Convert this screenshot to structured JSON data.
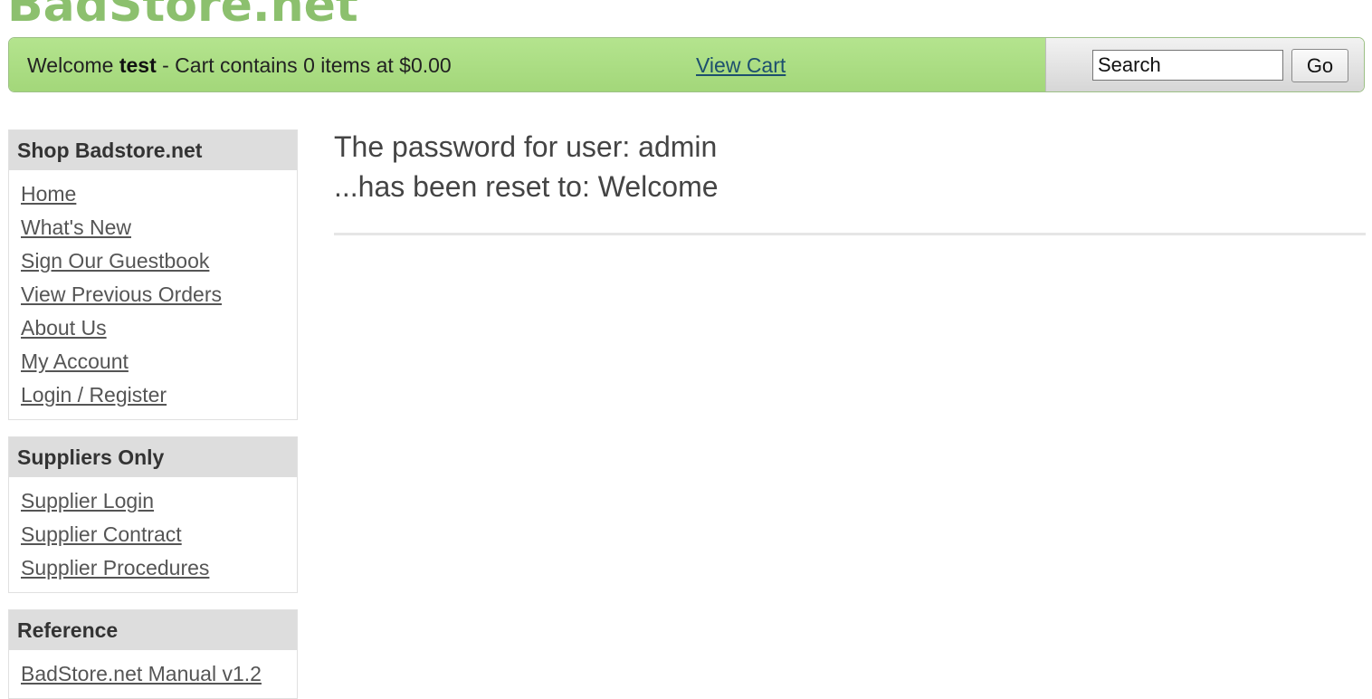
{
  "logo": {
    "text": "BadStore.net"
  },
  "topbar": {
    "welcome_prefix": "Welcome ",
    "username": "test",
    "cart_summary": " - Cart contains 0 items at $0.00",
    "view_cart_label": "View Cart",
    "search_value": "Search",
    "go_label": "Go"
  },
  "sidebar": {
    "shop": {
      "title": "Shop Badstore.net",
      "items": [
        {
          "label": "Home"
        },
        {
          "label": "What's New"
        },
        {
          "label": "Sign Our Guestbook"
        },
        {
          "label": "View Previous Orders"
        },
        {
          "label": "About Us"
        },
        {
          "label": "My Account"
        },
        {
          "label": "Login / Register"
        }
      ]
    },
    "suppliers": {
      "title": "Suppliers Only",
      "items": [
        {
          "label": "Supplier Login"
        },
        {
          "label": "Supplier Contract"
        },
        {
          "label": "Supplier Procedures"
        }
      ]
    },
    "reference": {
      "title": "Reference",
      "items": [
        {
          "label": "BadStore.net Manual v1.2"
        }
      ]
    }
  },
  "main": {
    "line1": "The password for user: admin",
    "line2": "...has been reset to: Welcome"
  },
  "colors": {
    "logo": "#8cc06e",
    "topbar_green": "#a3d77a",
    "link": "#555555",
    "view_cart_link": "#1d4f6e"
  }
}
